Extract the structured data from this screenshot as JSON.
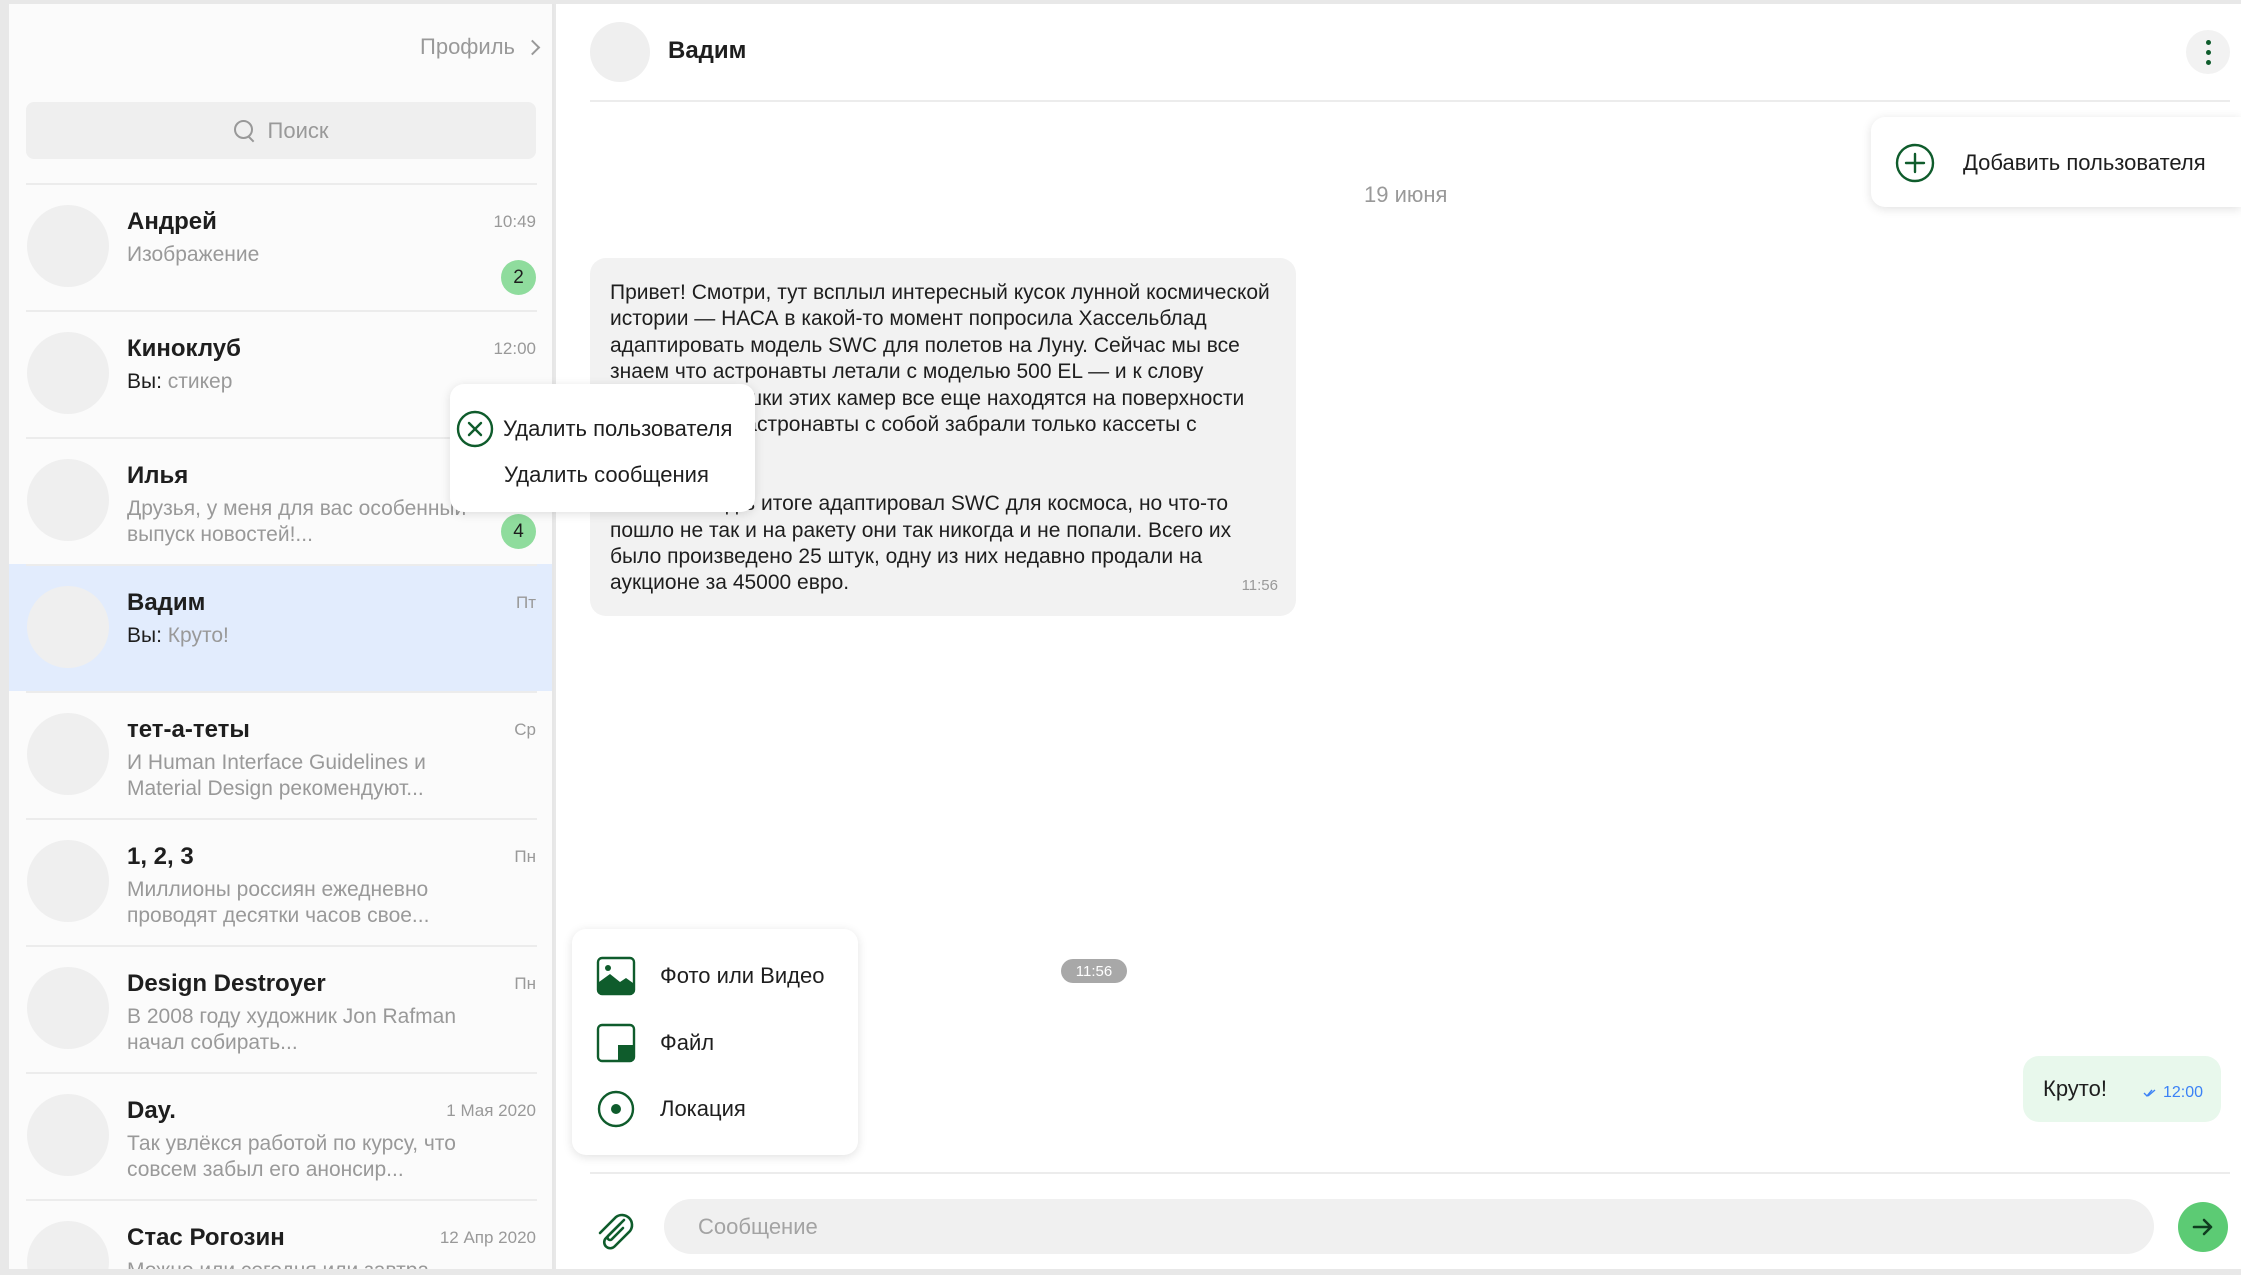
{
  "colors": {
    "accent": "#0f5c2c",
    "send": "#5ccb74",
    "badge": "#8fdc9d",
    "active_chat": "#e2ecfd",
    "read_check": "#3b82f6"
  },
  "sidebar": {
    "profile_link": "Профиль",
    "search_placeholder": "Поиск",
    "chats": [
      {
        "name": "Андрей",
        "time": "10:49",
        "preview": "Изображение",
        "badge": "2"
      },
      {
        "name": "Киноклуб",
        "time": "12:00",
        "preview_prefix": "Вы:",
        "preview": "стикер"
      },
      {
        "name": "Илья",
        "time": "",
        "preview": "Друзья, у меня для вас особенный выпуск новостей!...",
        "badge": "4"
      },
      {
        "name": "Вадим",
        "time": "Пт",
        "preview_prefix": "Вы:",
        "preview": "Круто!",
        "active": true
      },
      {
        "name": "тет-а-теты",
        "time": "Ср",
        "preview": "И Human Interface Guidelines и Material Design рекомендуют..."
      },
      {
        "name": "1, 2, 3",
        "time": "Пн",
        "preview": "Миллионы россиян ежедневно проводят десятки часов свое..."
      },
      {
        "name": "Design Destroyer",
        "time": "Пн",
        "preview": "В 2008 году художник Jon Rafman  начал собирать..."
      },
      {
        "name": "Day.",
        "time": "1 Мая 2020",
        "preview": "Так увлёкся работой по курсу, что совсем забыл его анонсир..."
      },
      {
        "name": "Стас Рогозин",
        "time": "12 Апр 2020",
        "preview": "Можно или сегодня или завтра вечером?"
      }
    ]
  },
  "chat": {
    "title": "Вадим",
    "date_separator": "19 июня",
    "incoming_message": {
      "text": "Привет! Смотри, тут всплыл интересный кусок лунной космической истории — НАСА в какой-то момент попросила Хассельблад адаптировать модель SWC для полетов на Луну. Сейчас мы все знаем что астронавты летали с моделью 500 EL — и к слову говоря, все тушки этих камер все еще находятся на поверхности Луны, так как астронавты с собой забрали только кассеты с пленкой.\n\nХассельблад в итоге адаптировал SWC для космоса, но что-то пошло не так и на ракету они так никогда и не попали. Всего их было произведено 25 штук, одну из них недавно продали на аукционе за 45000 евро.",
      "time": "11:56"
    },
    "image_time_chip": "11:56",
    "outgoing_message": {
      "text": "Круто!",
      "time": "12:00"
    },
    "composer_placeholder": "Сообщение"
  },
  "context_menu": {
    "delete_user": "Удалить пользователя",
    "delete_messages": "Удалить сообщения"
  },
  "add_user_popup": {
    "label": "Добавить пользователя"
  },
  "attach_menu": {
    "photo_video": "Фото или Видео",
    "file": "Файл",
    "location": "Локация"
  }
}
